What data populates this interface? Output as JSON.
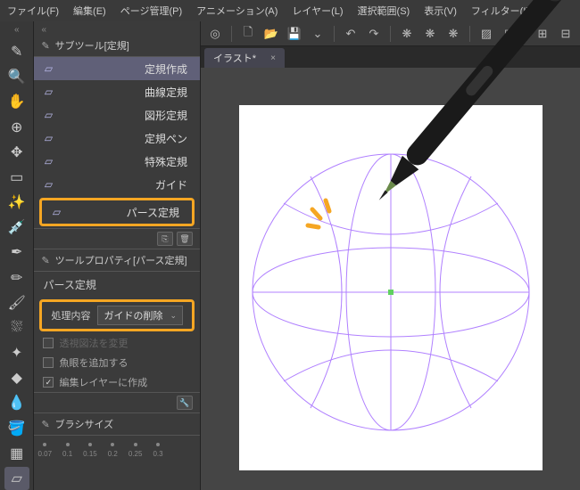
{
  "menubar": {
    "file": "ファイル(F)",
    "edit": "編集(E)",
    "page": "ページ管理(P)",
    "anim": "アニメーション(A)",
    "layer": "レイヤー(L)",
    "select": "選択範囲(S)",
    "view": "表示(V)",
    "filter": "フィルター(I)"
  },
  "subtool_panel": {
    "title": "サブツール[定規]",
    "items": [
      {
        "label": "定規作成",
        "selected": true
      },
      {
        "label": "曲線定規",
        "selected": false
      },
      {
        "label": "図形定規",
        "selected": false
      },
      {
        "label": "定規ペン",
        "selected": false
      },
      {
        "label": "特殊定規",
        "selected": false
      },
      {
        "label": "ガイド",
        "selected": false
      },
      {
        "label": "パース定規",
        "selected": false,
        "highlighted": true
      }
    ]
  },
  "tool_props": {
    "title": "ツールプロパティ[パース定規]",
    "subtitle": "パース定規",
    "proc_label": "処理内容",
    "proc_value": "ガイドの削除",
    "check1": "透視図法を変更",
    "check2": "魚眼を追加する",
    "check3": "編集レイヤーに作成"
  },
  "brush": {
    "title": "ブラシサイズ",
    "sizes": [
      "0.07",
      "0.1",
      "0.15",
      "0.2",
      "0.25",
      "0.3"
    ]
  },
  "tab": {
    "name": "イラスト*"
  }
}
